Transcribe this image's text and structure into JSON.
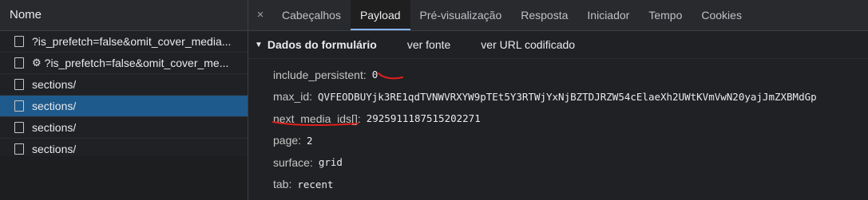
{
  "network_list": {
    "header": "Nome",
    "rows": [
      {
        "label": "?is_prefetch=false&omit_cover_media...",
        "icon": "document-icon",
        "gear": false,
        "selected": false
      },
      {
        "label": "?is_prefetch=false&omit_cover_me...",
        "icon": "document-icon",
        "gear": true,
        "selected": false
      },
      {
        "label": "sections/",
        "icon": "document-icon",
        "gear": false,
        "selected": false
      },
      {
        "label": "sections/",
        "icon": "document-icon",
        "gear": false,
        "selected": true
      },
      {
        "label": "sections/",
        "icon": "document-icon",
        "gear": false,
        "selected": false
      },
      {
        "label": "sections/",
        "icon": "document-icon",
        "gear": false,
        "selected": false
      }
    ]
  },
  "tabs": {
    "close": "×",
    "items": [
      "Cabeçalhos",
      "Payload",
      "Pré-visualização",
      "Resposta",
      "Iniciador",
      "Tempo",
      "Cookies"
    ],
    "active": "Payload"
  },
  "form_data": {
    "title": "Dados do formulário",
    "view_source": "ver fonte",
    "view_url_encoded": "ver URL codificado",
    "params": [
      {
        "key": "include_persistent:",
        "value": "0"
      },
      {
        "key": "max_id:",
        "value": "QVFEODBUYjk3RE1qdTVNWVRXYW9pTEt5Y3RTWjYxNjBZTDJRZW54cElaeXh2UWtKVmVwN20yajJmZXBMdGp"
      },
      {
        "key": "next_media_ids[]:",
        "value": "2925911187515202271"
      },
      {
        "key": "page:",
        "value": "2"
      },
      {
        "key": "surface:",
        "value": "grid"
      },
      {
        "key": "tab:",
        "value": "recent"
      }
    ]
  },
  "colors": {
    "accent": "#8ab4f8",
    "selected_row": "#1f5a8c",
    "annotation_red": "#e0201c"
  }
}
